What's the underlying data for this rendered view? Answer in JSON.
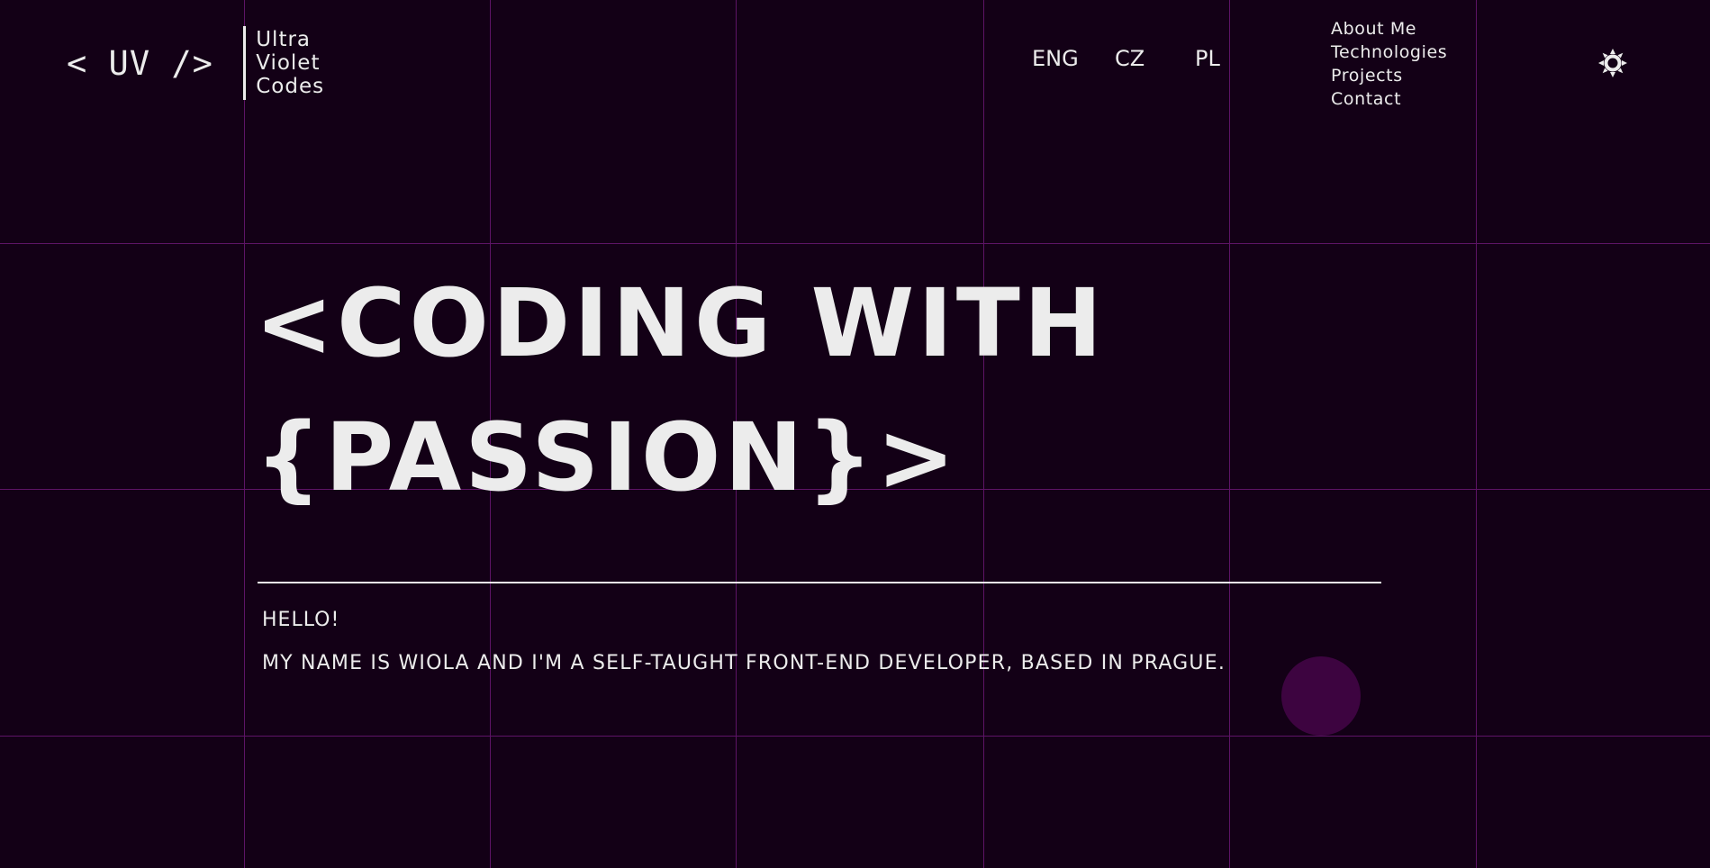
{
  "logo": {
    "mark": "< UV /> ",
    "words": [
      "Ultra",
      "Violet",
      "Codes"
    ]
  },
  "languages": [
    "ENG",
    "CZ",
    "PL"
  ],
  "nav": [
    "About Me",
    "Technologies",
    "Projects",
    "Contact"
  ],
  "theme_toggle": {
    "icon": "sun-icon"
  },
  "hero": {
    "line1": "<CODING WITH",
    "line2": "{PASSION}>"
  },
  "intro": {
    "greeting": "HELLO!",
    "text": "MY NAME IS WIOLA AND I'M A SELF-TAUGHT FRONT-END DEVELOPER, BASED IN PRAGUE."
  },
  "colors": {
    "background": "#130016",
    "grid": "#5d1466",
    "text": "#ececec",
    "blob": "#3d0440"
  }
}
